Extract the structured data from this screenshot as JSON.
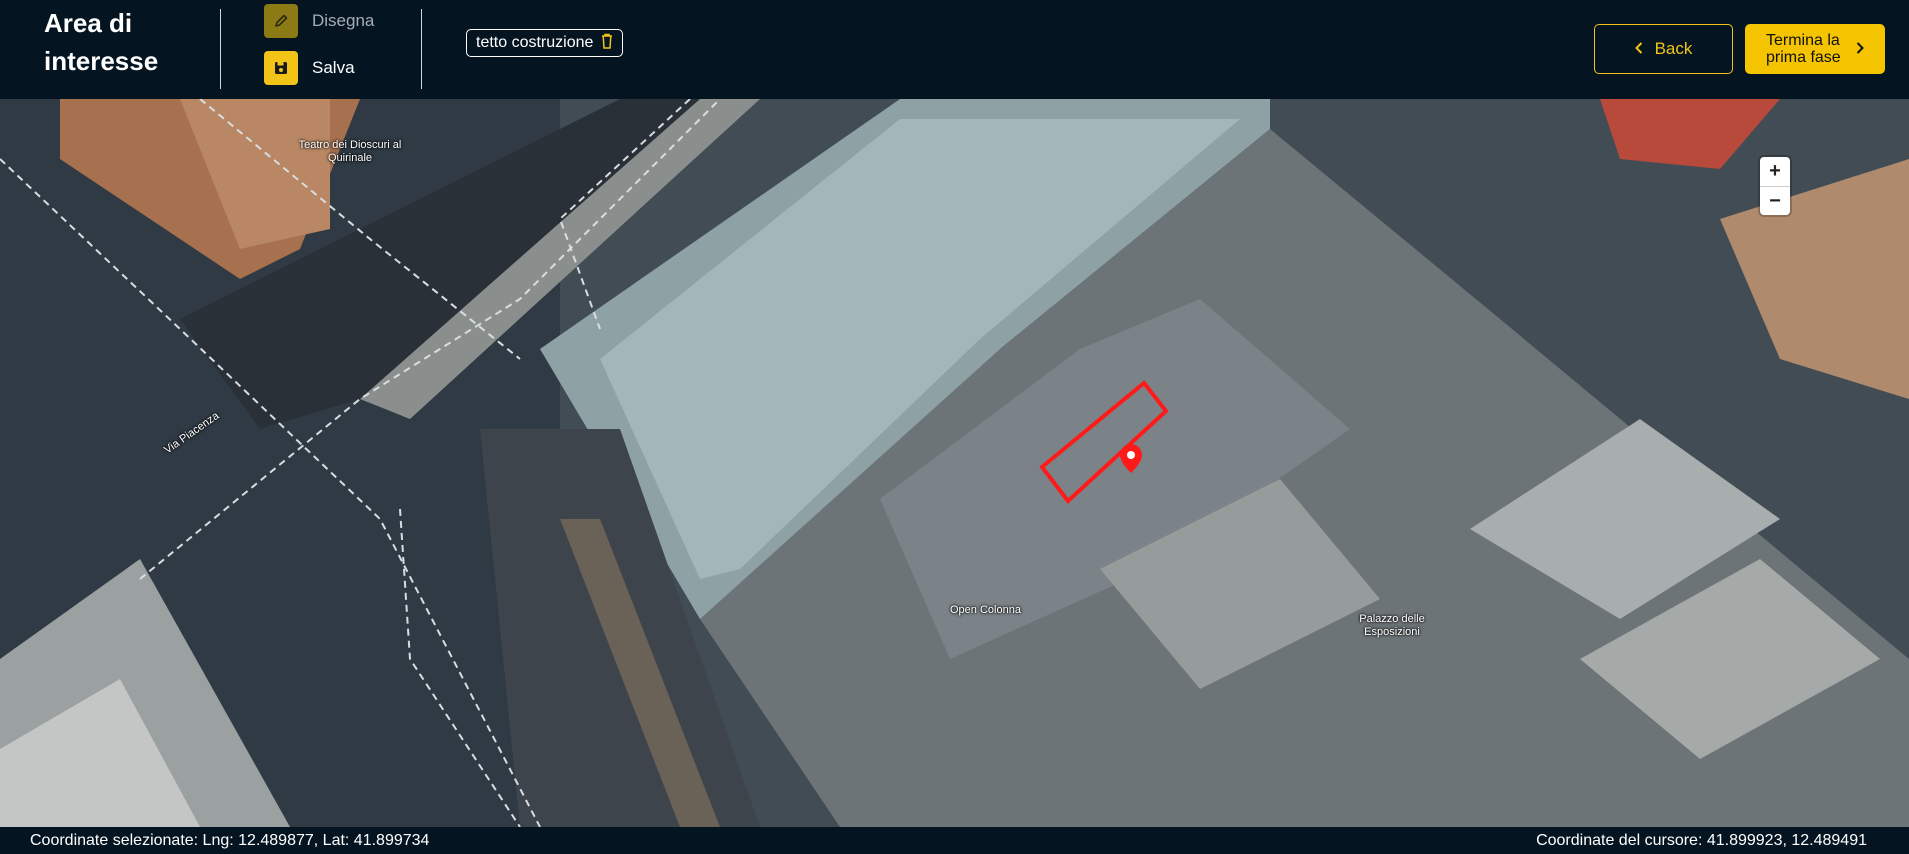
{
  "header": {
    "title": "Area di interesse",
    "tools": {
      "draw_label": "Disegna",
      "save_label": "Salva"
    },
    "chip_label": "tetto costruzione",
    "back_label": "Back",
    "next_label": "Termina la prima fase"
  },
  "map": {
    "zoom_in": "+",
    "zoom_out": "−",
    "labels": {
      "teatro": "Teatro dei Dioscuri al Quirinale",
      "via_piacenza": "Via Piacenza",
      "open_colonna": "Open Colonna",
      "palazzo": "Palazzo delle Esposizioni"
    },
    "polygon_color": "#ff1a1a",
    "pin_color": "#ff1a1a"
  },
  "footer": {
    "selected_coords": "Coordinate selezionate: Lng: 12.489877, Lat: 41.899734",
    "cursor_coords": "Coordinate del cursore: 41.899923, 12.489491"
  },
  "colors": {
    "accent": "#f5c400",
    "bar_bg": "#041521"
  },
  "icons": {
    "draw": "pencil-icon",
    "save": "floppy-disk-icon",
    "delete": "trash-icon",
    "back": "chevron-left-icon",
    "next": "chevron-right-icon"
  }
}
